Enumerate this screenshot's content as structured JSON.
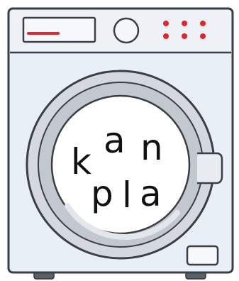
{
  "machine": {
    "drum_letters": [
      {
        "id": "k",
        "text": "k"
      },
      {
        "id": "a-top",
        "text": "a"
      },
      {
        "id": "n",
        "text": "n"
      },
      {
        "id": "p",
        "text": "p"
      },
      {
        "id": "l",
        "text": "l"
      },
      {
        "id": "a-bottom",
        "text": "a"
      }
    ],
    "colors": {
      "body": "#e8eef6",
      "panel": "#eef2f7",
      "outline": "#3a3f47",
      "display_bar": "#e0262a",
      "indicator_dots": "#e0262a",
      "door_ring": "#c9cdd3",
      "drum_window": "#ffffff"
    },
    "icons": [
      "display-panel",
      "control-knob",
      "indicator-lights",
      "door",
      "detergent-drawer",
      "feet"
    ]
  }
}
